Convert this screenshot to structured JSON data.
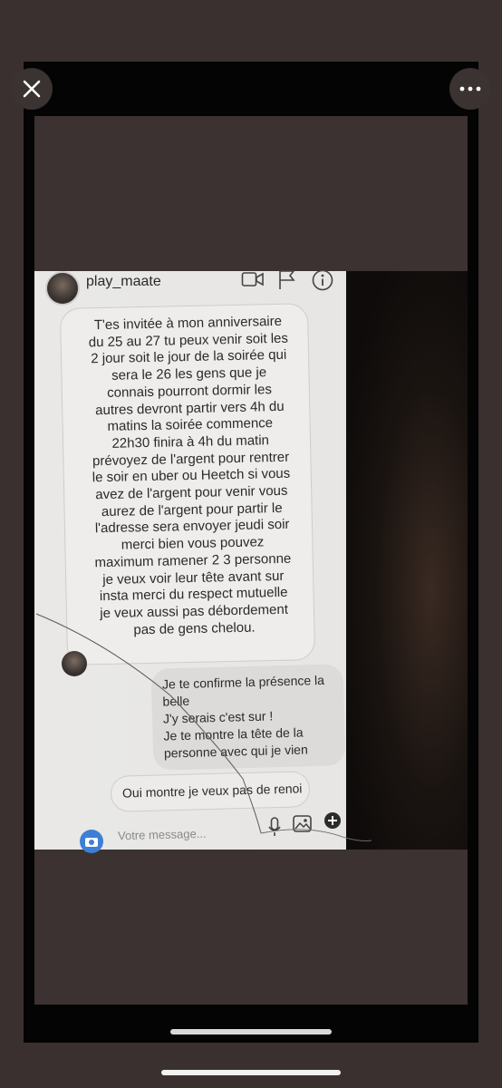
{
  "viewer": {
    "close_icon": "close-icon",
    "more_icon": "more-icon"
  },
  "chat": {
    "username": "play_maate",
    "header_icons": [
      "video-call-icon",
      "flag-icon",
      "info-icon"
    ],
    "incoming_message": "T'es invitée à mon anniversaire\ndu 25 au 27 tu peux venir soit les\n2 jour soit le jour de la soirée qui\nsera le 26 les gens que je\nconnais pourront dormir les\nautres devront partir vers 4h du\nmatins la soirée commence\n22h30 finira à 4h du matin\nprévoyez de l'argent pour rentrer\nle soir en uber ou Heetch si vous\navez de l'argent pour venir vous\naurez de l'argent pour partir le\nl'adresse sera envoyer jeudi soir\nmerci bien vous pouvez\nmaximum ramener 2 3 personne\nje veux voir leur tête avant sur\ninsta merci du respect mutuelle\nje veux aussi pas débordement\npas de gens chelou.",
    "outgoing_message": "Je te confirme la présence la\nbelle\nJ'y serais c'est sur !\nJe te montre la tête de la\npersonne avec qui je vien",
    "quick_reply": "Oui montre je veux pas de renoi",
    "composer_placeholder": "Votre message...",
    "composer_icons": [
      "camera-icon",
      "microphone-icon",
      "gallery-icon",
      "plus-icon"
    ]
  },
  "colors": {
    "background": "#3a3030",
    "accent": "#3d7fd6"
  }
}
